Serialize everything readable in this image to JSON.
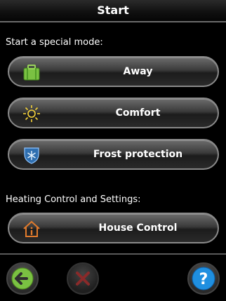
{
  "header": {
    "title": "Start"
  },
  "special_modes": {
    "label": "Start a special mode:",
    "buttons": [
      {
        "label": "Away",
        "icon": "suitcase-icon"
      },
      {
        "label": "Comfort",
        "icon": "sun-icon"
      },
      {
        "label": "Frost protection",
        "icon": "snowflake-shield-icon"
      }
    ]
  },
  "heating": {
    "label": "Heating Control and Settings:",
    "button": {
      "label": "House Control",
      "icon": "house-info-icon"
    }
  },
  "footer": {
    "back": {
      "icon": "back-arrow-icon"
    },
    "cancel": {
      "icon": "close-icon"
    },
    "help": {
      "icon": "help-icon",
      "glyph": "?"
    }
  },
  "colors": {
    "accent_green": "#7ac142",
    "help_blue": "#1f8fe0",
    "cancel_red": "#8a2a2a"
  }
}
